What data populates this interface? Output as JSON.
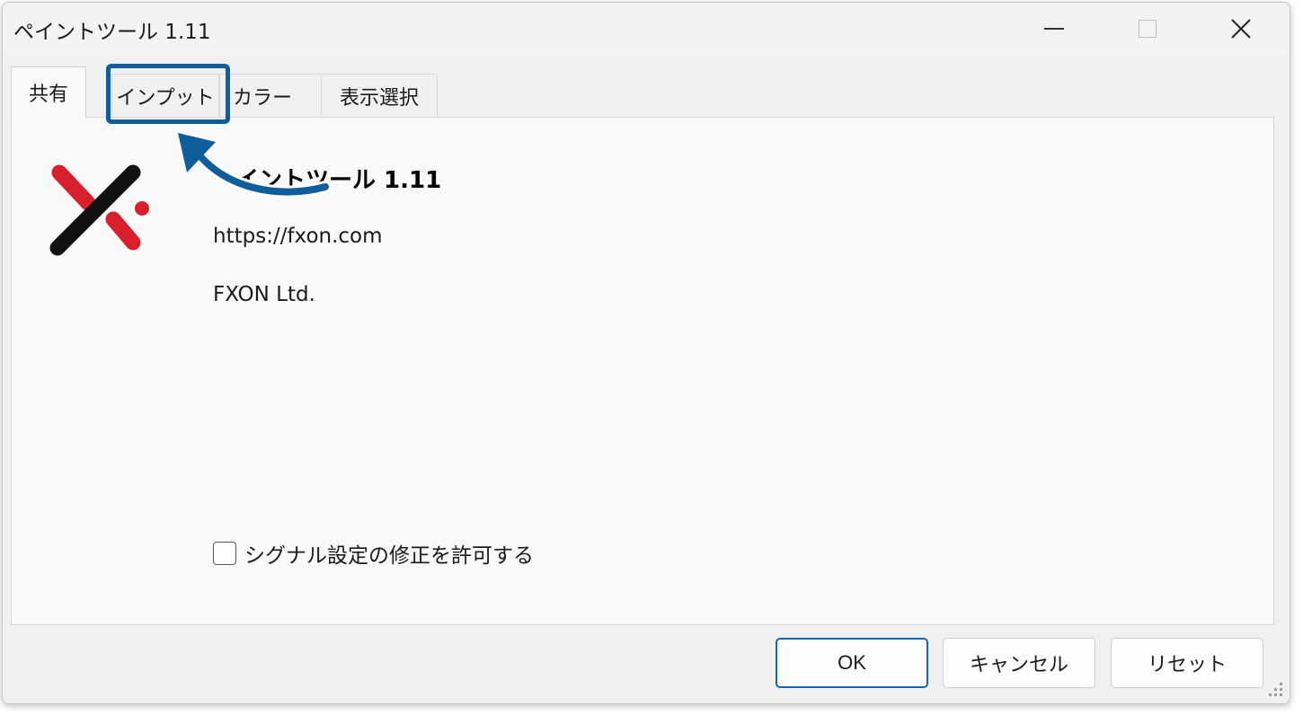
{
  "window": {
    "title": "ペイントツール 1.11",
    "controls": {
      "minimize_icon": "minimize-icon",
      "maximize_icon": "maximize-icon",
      "close_icon": "close-icon"
    }
  },
  "tabs": [
    {
      "label": "共有",
      "active": true
    },
    {
      "label": "インプット",
      "active": false,
      "highlighted": true
    },
    {
      "label": "カラー",
      "active": false
    },
    {
      "label": "表示選択",
      "active": false
    }
  ],
  "about": {
    "product_title": "イントツール 1.11",
    "url": "https://fxon.com",
    "company": "FXON Ltd."
  },
  "options": {
    "allow_signal_edit_label": "シグナル設定の修正を許可する",
    "allow_signal_edit_checked": false
  },
  "buttons": {
    "ok": "OK",
    "cancel": "キャンセル",
    "reset": "リセット"
  },
  "colors": {
    "highlight": "#0f5d9a",
    "logo_red": "#d81f2c",
    "logo_black": "#111111"
  }
}
